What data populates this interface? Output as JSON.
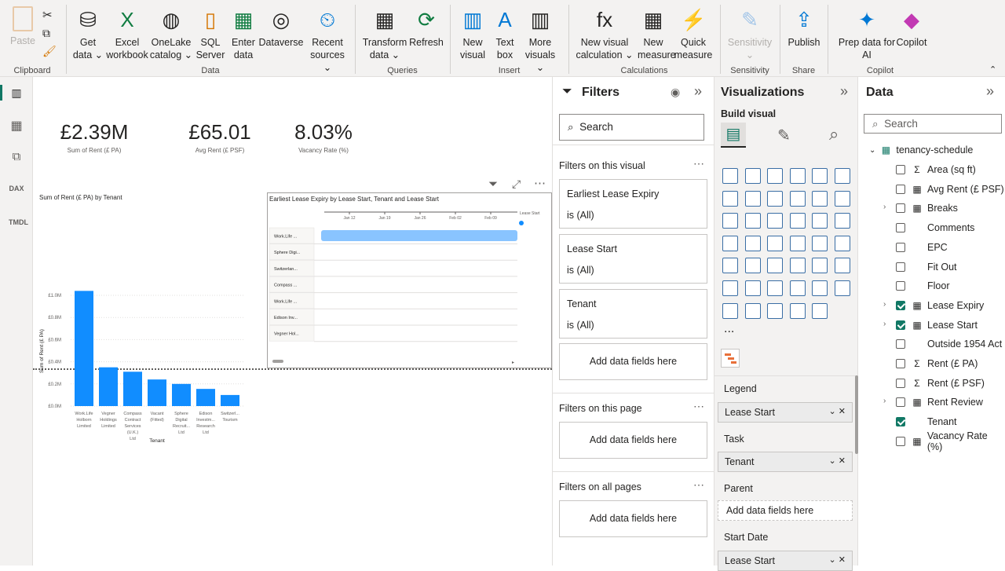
{
  "ribbon": {
    "groups": [
      {
        "label": "Clipboard"
      },
      {
        "label": "Data"
      },
      {
        "label": "Queries"
      },
      {
        "label": "Insert"
      },
      {
        "label": "Calculations"
      },
      {
        "label": "Sensitivity"
      },
      {
        "label": "Share"
      },
      {
        "label": "Copilot"
      }
    ],
    "paste": "Paste",
    "buttons": [
      {
        "l1": "Get",
        "l2": "data ⌄"
      },
      {
        "l1": "Excel",
        "l2": "workbook"
      },
      {
        "l1": "OneLake",
        "l2": "catalog ⌄"
      },
      {
        "l1": "SQL",
        "l2": "Server"
      },
      {
        "l1": "Enter",
        "l2": "data"
      },
      {
        "l1": "Dataverse",
        "l2": ""
      },
      {
        "l1": "Recent",
        "l2": "sources ⌄"
      },
      {
        "l1": "Transform",
        "l2": "data ⌄"
      },
      {
        "l1": "Refresh",
        "l2": ""
      },
      {
        "l1": "New",
        "l2": "visual"
      },
      {
        "l1": "Text",
        "l2": "box"
      },
      {
        "l1": "More",
        "l2": "visuals ⌄"
      },
      {
        "l1": "New visual",
        "l2": "calculation ⌄"
      },
      {
        "l1": "New",
        "l2": "measure"
      },
      {
        "l1": "Quick",
        "l2": "measure"
      },
      {
        "l1": "Sensitivity",
        "l2": "⌄"
      },
      {
        "l1": "Publish",
        "l2": ""
      },
      {
        "l1": "Prep data for",
        "l2": "AI"
      },
      {
        "l1": "Copilot",
        "l2": ""
      }
    ]
  },
  "rail": {
    "dax": "DAX",
    "tmdl": "TMDL"
  },
  "kpis": [
    {
      "value": "£2.39M",
      "label": "Sum of Rent (£ PA)"
    },
    {
      "value": "£65.01",
      "label": "Avg Rent (£ PSF)"
    },
    {
      "value": "8.03%",
      "label": "Vacancy Rate (%)"
    }
  ],
  "chart_data": [
    {
      "type": "bar",
      "title": "Sum of Rent (£ PA) by Tenant",
      "xlabel": "Tenant",
      "ylabel": "Sum of Rent (£ PA)",
      "ylim": [
        0,
        1.0
      ],
      "yticks": [
        "£0.0M",
        "£0.2M",
        "£0.4M",
        "£0.6M",
        "£0.8M",
        "£1.0M"
      ],
      "categories": [
        "Work.Life Holborn Limited",
        "Vegner Holdings Limited",
        "Compass Contract Services (U.K.) Ltd",
        "Vacant (Fitted)",
        "Sphere Digital Recruit... Ltd",
        "Edison Investm... Research Ltd",
        "Switzerl... Tourism"
      ],
      "values": [
        1.04,
        0.35,
        0.31,
        0.24,
        0.2,
        0.155,
        0.1
      ],
      "color": "#118dff",
      "grid": true
    },
    {
      "type": "gantt",
      "title": "Earliest Lease Expiry by Lease Start, Tenant and Lease Start",
      "xticks": [
        "Jan 12",
        "Jan 19",
        "Jan 26",
        "Feb 02",
        "Feb 09"
      ],
      "legend_title": "Lease Start",
      "rows": [
        "Work.Life ...",
        "Sphere Digi...",
        "Switzerlan...",
        "Compass ...",
        "Work.Life ...",
        "Edison Inv...",
        "Vegner Hol..."
      ],
      "bar_color": "#89c4ff"
    }
  ],
  "filters": {
    "title": "Filters",
    "search": "Search",
    "on_visual": "Filters on this visual",
    "on_page": "Filters on this page",
    "on_all": "Filters on all pages",
    "add": "Add data fields here",
    "cards": [
      {
        "name": "Earliest Lease Expiry",
        "state": "is (All)"
      },
      {
        "name": "Lease Start",
        "state": "is (All)"
      },
      {
        "name": "Tenant",
        "state": "is (All)"
      }
    ]
  },
  "viz": {
    "title": "Visualizations",
    "build": "Build visual",
    "more": "...",
    "wells": [
      {
        "label": "Legend",
        "value": "Lease Start"
      },
      {
        "label": "Task",
        "value": "Tenant"
      },
      {
        "label": "Parent",
        "value": "Add data fields here"
      },
      {
        "label": "Start Date",
        "value": "Lease Start"
      }
    ],
    "icons": [
      "stacked-bar",
      "stacked-column",
      "clustered-bar",
      "clustered-column",
      "100-bar",
      "100-column",
      "line",
      "area",
      "stacked-area",
      "100-area",
      "line-column",
      "line-clustered",
      "ribbon",
      "waterfall",
      "funnel",
      "scatter",
      "pie",
      "donut",
      "treemap",
      "map",
      "filled-map",
      "azure-map",
      "gauge",
      "card",
      "multi-row-card",
      "kpi",
      "slicer",
      "table",
      "matrix",
      "r-visual",
      "python",
      "key-influencers",
      "decomposition-tree",
      "qa",
      "narrative",
      "goals",
      "paginated",
      "power-apps",
      "power-automate",
      "kpi-card",
      "arcgis",
      "more-visuals"
    ]
  },
  "data": {
    "title": "Data",
    "search": "Search",
    "table": "tenancy-schedule",
    "fields": [
      {
        "name": "Area (sq ft)",
        "icon": "Σ",
        "checked": false,
        "expand": false
      },
      {
        "name": "Avg Rent (£ PSF)",
        "icon": "▦",
        "checked": false,
        "expand": false
      },
      {
        "name": "Breaks",
        "icon": "▦",
        "checked": false,
        "expand": true
      },
      {
        "name": "Comments",
        "icon": "",
        "checked": false,
        "expand": false
      },
      {
        "name": "EPC",
        "icon": "",
        "checked": false,
        "expand": false
      },
      {
        "name": "Fit Out",
        "icon": "",
        "checked": false,
        "expand": false
      },
      {
        "name": "Floor",
        "icon": "",
        "checked": false,
        "expand": false
      },
      {
        "name": "Lease Expiry",
        "icon": "▦",
        "checked": true,
        "expand": true
      },
      {
        "name": "Lease Start",
        "icon": "▦",
        "checked": true,
        "expand": true
      },
      {
        "name": "Outside 1954 Act",
        "icon": "",
        "checked": false,
        "expand": false
      },
      {
        "name": "Rent (£ PA)",
        "icon": "Σ",
        "checked": false,
        "expand": false
      },
      {
        "name": "Rent (£ PSF)",
        "icon": "Σ",
        "checked": false,
        "expand": false
      },
      {
        "name": "Rent Review",
        "icon": "▦",
        "checked": false,
        "expand": true
      },
      {
        "name": "Tenant",
        "icon": "",
        "checked": true,
        "expand": false
      },
      {
        "name": "Vacancy Rate (%)",
        "icon": "▦",
        "checked": false,
        "expand": false
      }
    ]
  }
}
